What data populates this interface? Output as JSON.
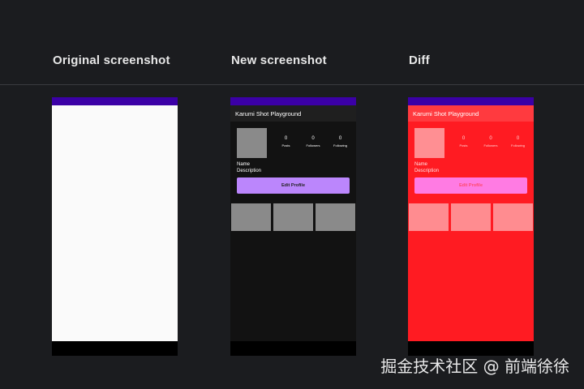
{
  "headers": {
    "original": "Original screenshot",
    "new": "New screenshot",
    "diff": "Diff"
  },
  "mock": {
    "app_title": "Karumi Shot Playground",
    "stats": [
      {
        "value": "0",
        "label": "Posts"
      },
      {
        "value": "0",
        "label": "Followers"
      },
      {
        "value": "0",
        "label": "Following"
      }
    ],
    "name": "Name",
    "description": "Description",
    "edit_button": "Edit Profile"
  },
  "watermark": "掘金技术社区 @ 前端徐徐",
  "colors": {
    "background": "#1b1c1f",
    "status_bar": "#3b00a6",
    "new_background": "#121212",
    "diff_background": "#ff1b22",
    "edit_button_new": "#bb86fc",
    "edit_button_diff": "#ff7be3"
  }
}
